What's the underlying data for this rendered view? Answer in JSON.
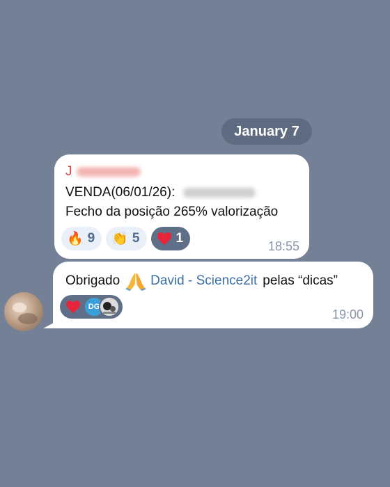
{
  "date_separator": "January 7",
  "messages": [
    {
      "sender_initial": "J",
      "line1": "VENDA(06/01/26):",
      "line2": "Fecho da posição 265% valorização",
      "reactions": [
        {
          "icon": "fire-icon",
          "emoji": "🔥",
          "count": "9",
          "chosen": false
        },
        {
          "icon": "clap-icon",
          "emoji": "👏",
          "count": "5",
          "chosen": false
        },
        {
          "icon": "heart-icon",
          "emoji": "❤️",
          "count": "1",
          "chosen": true
        }
      ],
      "time": "18:55"
    },
    {
      "text_before": "Obrigado",
      "mention": "David - Science2it",
      "text_after": "pelas “dicas”",
      "reaction": {
        "icon": "heart-icon",
        "reactor_initials": "DG"
      },
      "time": "19:00"
    }
  ],
  "colors": {
    "background": "#738096",
    "sender_name": "#d0463e",
    "mention": "#3a6fa8",
    "chosen_reaction": "#5f6f87"
  }
}
